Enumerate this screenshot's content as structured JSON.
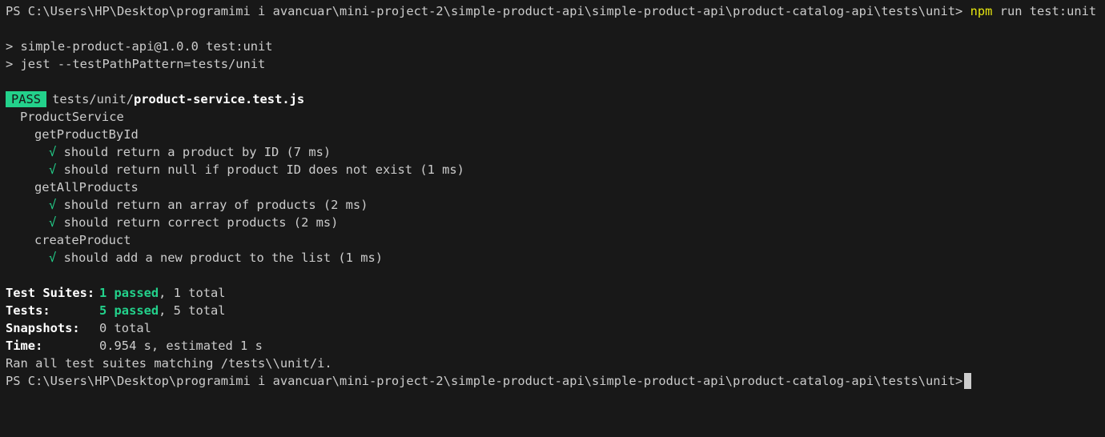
{
  "prompt1": {
    "path": "PS C:\\Users\\HP\\Desktop\\programimi i avancuar\\mini-project-2\\simple-product-api\\simple-product-api\\product-catalog-api\\tests\\unit>",
    "command": "npm",
    "args": "run test:unit"
  },
  "script_lines": [
    "> simple-product-api@1.0.0 test:unit",
    "> jest --testPathPattern=tests/unit"
  ],
  "result": {
    "badge": "PASS",
    "dir": "tests/unit/",
    "file": "product-service.test.js"
  },
  "suite": {
    "name": "ProductService",
    "groups": [
      {
        "name": "getProductById",
        "tests": [
          "should return a product by ID (7 ms)",
          "should return null if product ID does not exist (1 ms)"
        ]
      },
      {
        "name": "getAllProducts",
        "tests": [
          "should return an array of products (2 ms)",
          "should return correct products (2 ms)"
        ]
      },
      {
        "name": "createProduct",
        "tests": [
          "should add a new product to the list (1 ms)"
        ]
      }
    ]
  },
  "check_glyph": "√",
  "summary": {
    "suites_label": "Test Suites:",
    "suites_passed": "1 passed",
    "suites_total": ", 1 total",
    "tests_label": "Tests:",
    "tests_passed": "5 passed",
    "tests_total": ", 5 total",
    "snapshots_label": "Snapshots:",
    "snapshots_value": "0 total",
    "time_label": "Time:",
    "time_value": "0.954 s, estimated 1 s",
    "ran_line": "Ran all test suites matching /tests\\\\unit/i."
  },
  "prompt2": {
    "path": "PS C:\\Users\\HP\\Desktop\\programimi i avancuar\\mini-project-2\\simple-product-api\\simple-product-api\\product-catalog-api\\tests\\unit>"
  },
  "colors": {
    "background": "#181818",
    "text": "#cccccc",
    "command": "#e5e510",
    "pass_green": "#23d18b"
  }
}
